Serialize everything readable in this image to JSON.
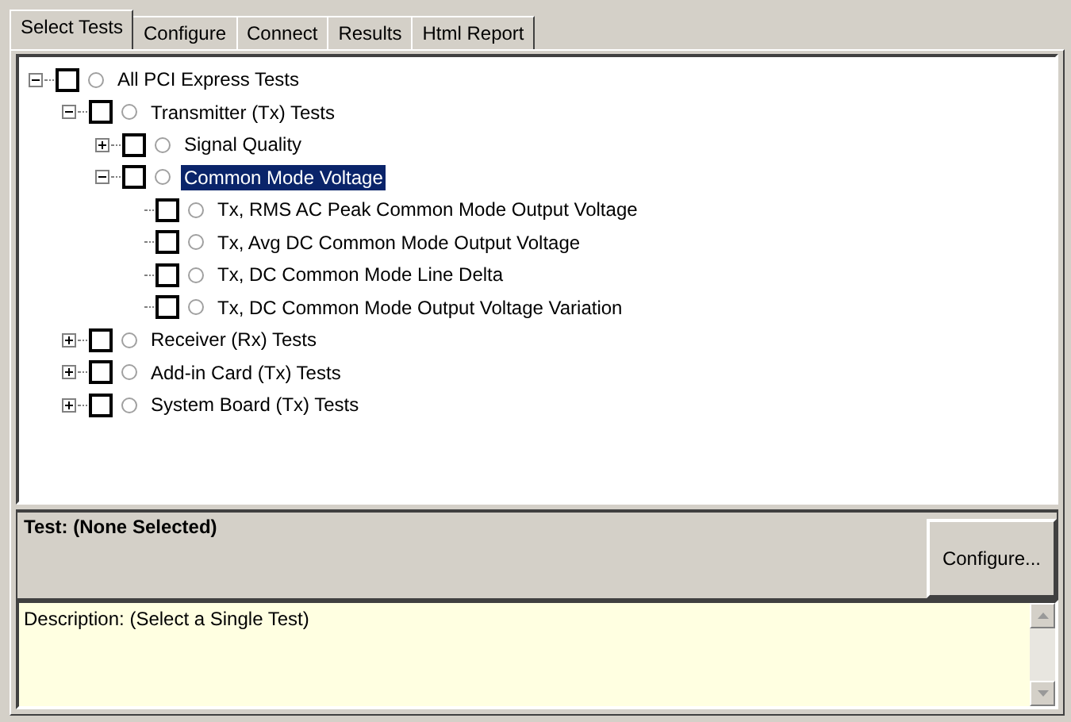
{
  "tabs": [
    {
      "label": "Select Tests",
      "selected": true
    },
    {
      "label": "Configure",
      "selected": false
    },
    {
      "label": "Connect",
      "selected": false
    },
    {
      "label": "Results",
      "selected": false
    },
    {
      "label": "Html Report",
      "selected": false
    }
  ],
  "tree": [
    {
      "label": "All PCI Express Tests",
      "checked": false,
      "selected": false,
      "expanded": true,
      "children": [
        {
          "label": "Transmitter (Tx) Tests",
          "checked": false,
          "selected": false,
          "expanded": true,
          "children": [
            {
              "label": "Signal Quality",
              "checked": false,
              "selected": false,
              "expanded": false
            },
            {
              "label": "Common Mode Voltage",
              "checked": false,
              "selected": true,
              "expanded": true,
              "children": [
                {
                  "label": "Tx, RMS AC Peak Common Mode Output Voltage",
                  "checked": false,
                  "selected": false
                },
                {
                  "label": "Tx, Avg DC Common Mode Output Voltage",
                  "checked": false,
                  "selected": false
                },
                {
                  "label": "Tx, DC Common Mode Line Delta",
                  "checked": false,
                  "selected": false
                },
                {
                  "label": "Tx, DC Common Mode Output Voltage Variation",
                  "checked": false,
                  "selected": false
                }
              ]
            }
          ]
        },
        {
          "label": "Receiver (Rx) Tests",
          "checked": false,
          "selected": false,
          "expanded": false
        },
        {
          "label": "Add-in Card (Tx) Tests",
          "checked": false,
          "selected": false,
          "expanded": false
        },
        {
          "label": "System Board (Tx) Tests",
          "checked": false,
          "selected": false,
          "expanded": false
        }
      ]
    }
  ],
  "test_label": "Test: (None Selected)",
  "configure_button": "Configure...",
  "description": "Description: (Select a Single Test)"
}
